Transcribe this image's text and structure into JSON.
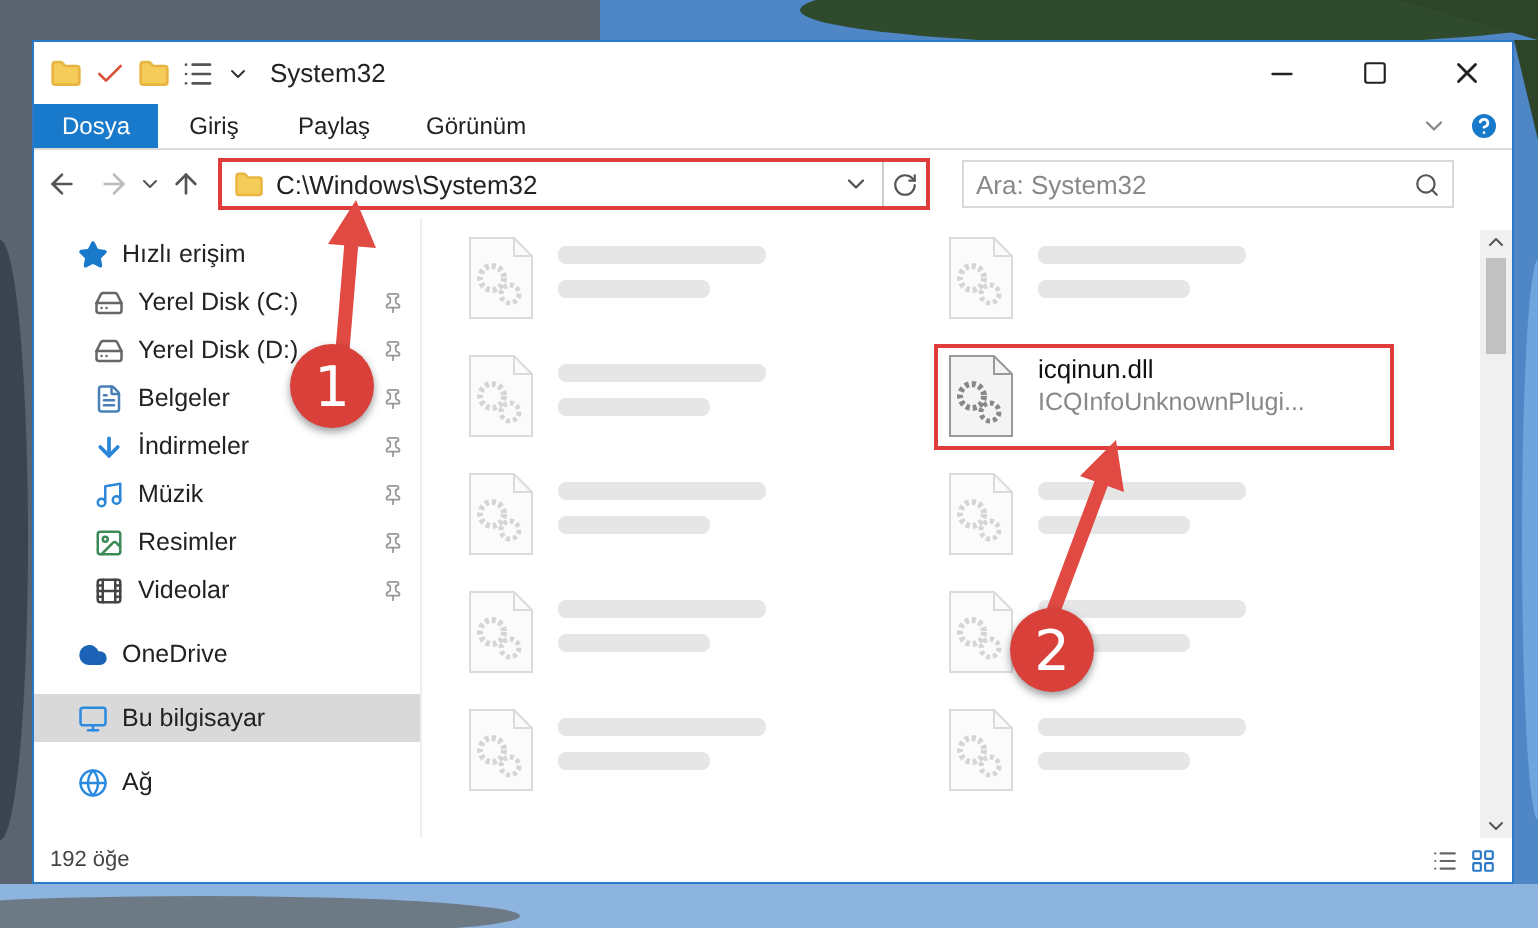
{
  "window": {
    "title": "System32"
  },
  "ribbon_tabs": [
    {
      "label": "Dosya",
      "selected": true
    },
    {
      "label": "Giriş",
      "selected": false
    },
    {
      "label": "Paylaş",
      "selected": false
    },
    {
      "label": "Görünüm",
      "selected": false
    }
  ],
  "address": {
    "path": "C:\\Windows\\System32",
    "highlighted": true
  },
  "search": {
    "placeholder": "Ara: System32"
  },
  "sidebar": {
    "items": [
      {
        "label": "Hızlı erişim",
        "kind": "star",
        "selected": false,
        "children": [
          {
            "label": "Yerel Disk (C:)",
            "kind": "drive-c",
            "pinned": true,
            "selected": false
          },
          {
            "label": "Yerel Disk (D:)",
            "kind": "drive",
            "pinned": true,
            "selected": false
          },
          {
            "label": "Belgeler",
            "kind": "docs",
            "pinned": true,
            "selected": false
          },
          {
            "label": "İndirmeler",
            "kind": "download",
            "pinned": true,
            "selected": false
          },
          {
            "label": "Müzik",
            "kind": "music",
            "pinned": true,
            "selected": false
          },
          {
            "label": "Resimler",
            "kind": "pictures",
            "pinned": true,
            "selected": false
          },
          {
            "label": "Videolar",
            "kind": "videos",
            "pinned": true,
            "selected": false
          }
        ]
      },
      {
        "label": "OneDrive",
        "kind": "cloud",
        "selected": false
      },
      {
        "label": "Bu bilgisayar",
        "kind": "pc",
        "selected": true
      },
      {
        "label": "Ağ",
        "kind": "network",
        "selected": false
      }
    ]
  },
  "files": [
    {
      "blurred": true,
      "highlighted": false
    },
    {
      "blurred": true,
      "highlighted": false
    },
    {
      "blurred": true,
      "highlighted": false
    },
    {
      "name": "icqinun.dll",
      "type": "ICQInfoUnknownPlugi...",
      "blurred": false,
      "highlighted": true
    },
    {
      "blurred": true,
      "highlighted": false
    },
    {
      "blurred": true,
      "highlighted": false
    },
    {
      "blurred": true,
      "highlighted": false
    },
    {
      "blurred": true,
      "highlighted": false
    },
    {
      "blurred": true,
      "highlighted": false
    },
    {
      "blurred": true,
      "highlighted": false
    }
  ],
  "status_bar": {
    "count": "192 öğe"
  },
  "annotations": [
    {
      "label": "1"
    },
    {
      "label": "2"
    }
  ]
}
